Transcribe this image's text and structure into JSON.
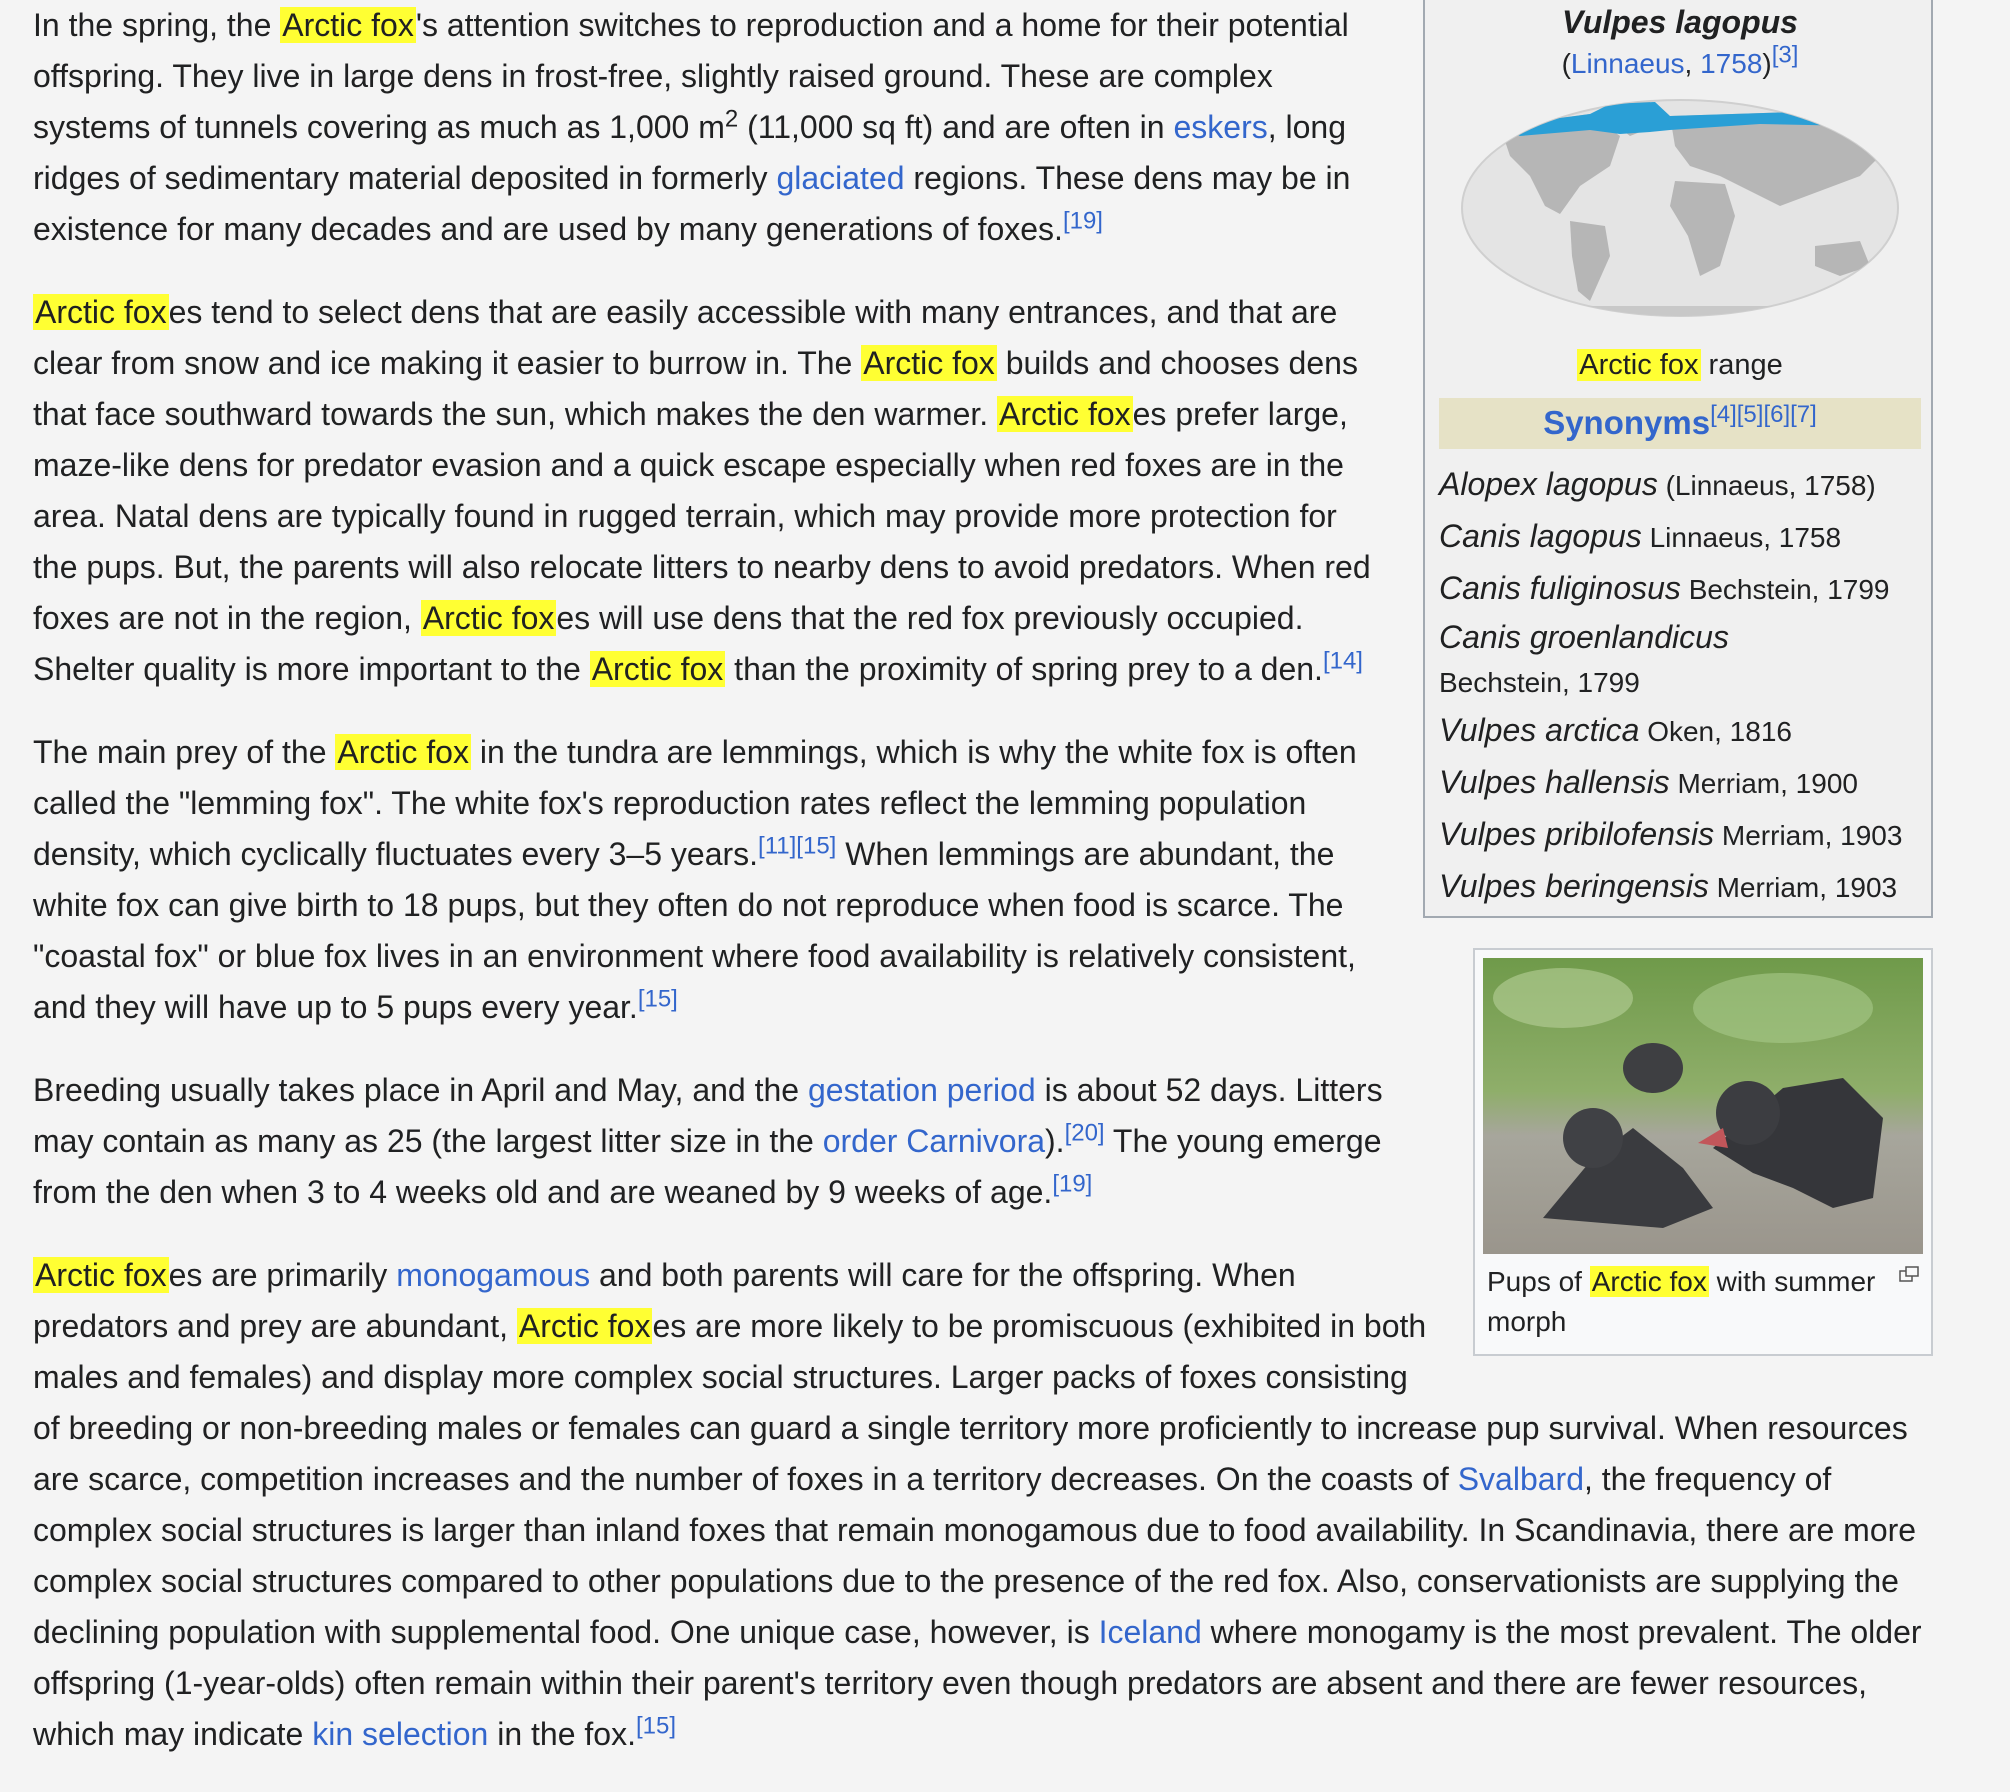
{
  "infobox": {
    "binomial": "Vulpes lagopus",
    "authority_open": "(",
    "authority_name": "Linnaeus",
    "authority_sep": ", ",
    "authority_year": "1758",
    "authority_close": ")",
    "authority_ref": "[3]",
    "map_caption_hl": "Arctic fox",
    "map_caption_rest": " range",
    "synonyms_title": "Synonyms",
    "synonyms_refs": "[4][5][6][7]",
    "synonyms": [
      {
        "name": "Alopex lagopus",
        "author": "(Linnaeus, 1758)"
      },
      {
        "name": "Canis lagopus",
        "author": "Linnaeus, 1758"
      },
      {
        "name": "Canis fuliginosus",
        "author": "Bechstein, 1799"
      },
      {
        "name": "Canis groenlandicus",
        "author": "Bechstein, 1799"
      },
      {
        "name": "Vulpes arctica",
        "author": "Oken, 1816"
      },
      {
        "name": "Vulpes hallensis",
        "author": "Merriam, 1900"
      },
      {
        "name": "Vulpes pribilofensis",
        "author": "Merriam, 1903"
      },
      {
        "name": "Vulpes beringensis",
        "author": "Merriam, 1903"
      }
    ]
  },
  "thumb": {
    "caption_pre": "Pups of ",
    "caption_hl": "Arctic fox",
    "caption_post": " with summer morph"
  },
  "p1": {
    "a": "In the spring, the ",
    "hl1": "Arctic fox",
    "b": "'s attention switches to reproduction and a home for their potential offspring. They live in large dens in frost-free, slightly raised ground. These are complex systems of tunnels covering as much as 1,000 m",
    "sup2": "2",
    "c": " (11,000 sq ft) and are often in ",
    "link1": "eskers",
    "d": ", long ridges of sedimentary material deposited in formerly ",
    "link2": "glaciated",
    "e": " regions. These dens may be in existence for many decades and are used by many generations of foxes.",
    "ref": "[19]"
  },
  "p2": {
    "hl1": "Arctic fox",
    "a": "es tend to select dens that are easily accessible with many entrances, and that are clear from snow and ice making it easier to burrow in. The ",
    "hl2": "Arctic fox",
    "b": " builds and chooses dens that face southward towards the sun, which makes the den warmer. ",
    "hl3": "Arctic fox",
    "c": "es prefer large, maze-like dens for predator evasion and a quick escape especially when red foxes are in the area. Natal dens are typically found in rugged terrain, which may provide more protection for the pups. But, the parents will also relocate litters to nearby dens to avoid predators. When red foxes are not in the region, ",
    "hl4": "Arctic fox",
    "d": "es will use dens that the red fox previously occupied. Shelter quality is more important to the ",
    "hl5": "Arctic fox",
    "e": " than the proximity of spring prey to a den.",
    "ref": "[14]"
  },
  "p3": {
    "a": "The main prey of the ",
    "hl1": "Arctic fox",
    "b": " in the tundra are lemmings, which is why the white fox is often called the \"lemming fox\". The white fox's reproduction rates reflect the lemming population density, which cyclically fluctuates every 3–5 years.",
    "ref1": "[11]",
    "ref2": "[15]",
    "c": " When lemmings are abundant, the white fox can give birth to 18 pups, but they often do not reproduce when food is scarce. The \"coastal fox\" or blue fox lives in an environment where food availability is relatively consistent, and they will have up to 5 pups every year.",
    "ref3": "[15]"
  },
  "p4": {
    "a": "Breeding usually takes place in April and May, and the ",
    "link1": "gestation period",
    "b": " is about 52 days. Litters may contain as many as 25 (the largest litter size in the ",
    "link2": "order Carnivora",
    "c": ").",
    "ref1": "[20]",
    "d": " The young emerge from the den when 3 to 4 weeks old and are weaned by 9 weeks of age.",
    "ref2": "[19]"
  },
  "p5": {
    "hl1": "Arctic fox",
    "a": "es are primarily ",
    "link1": "monogamous",
    "b": " and both parents will care for the offspring. When predators and prey are abundant, ",
    "hl2": "Arctic fox",
    "c": "es are more likely to be promiscuous (exhibited in both males and females) and display more complex social structures. Larger packs of foxes consisting of breeding or non-breeding males or females can guard a single territory more proficiently to increase pup survival. When resources are scarce, competition increases and the number of foxes in a territory decreases. On the coasts of ",
    "link2": "Svalbard",
    "d": ", the frequency of complex social structures is larger than inland foxes that remain monogamous due to food availability. In Scandinavia, there are more complex social structures compared to other populations due to the presence of the red fox. Also, conservationists are supplying the declining population with supplemental food. One unique case, however, is ",
    "link3": "Iceland",
    "e": " where monogamy is the most prevalent. The older offspring (1-year-olds) often remain within their parent's territory even though predators are absent and there are fewer resources, which may indicate ",
    "link4": "kin selection",
    "f": " in the fox.",
    "ref": "[15]"
  }
}
